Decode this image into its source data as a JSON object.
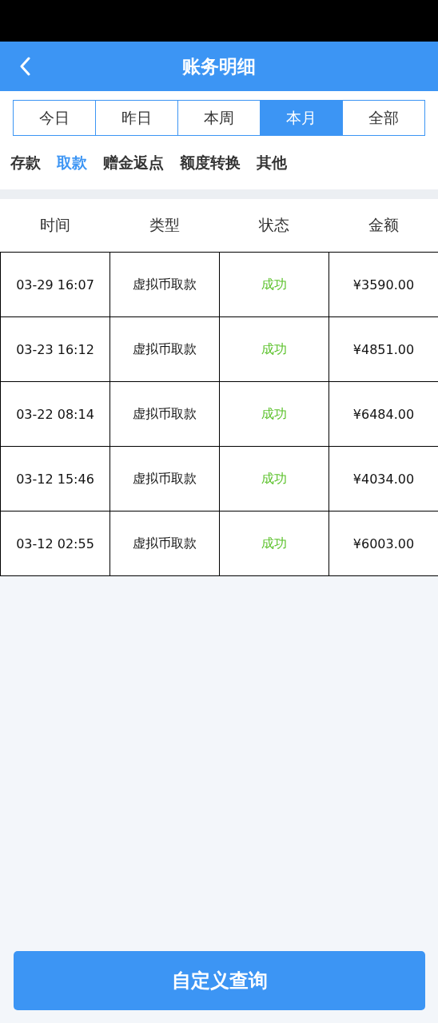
{
  "header": {
    "title": "账务明细"
  },
  "periods": [
    {
      "label": "今日",
      "selected": false
    },
    {
      "label": "昨日",
      "selected": false
    },
    {
      "label": "本周",
      "selected": false
    },
    {
      "label": "本月",
      "selected": true
    },
    {
      "label": "全部",
      "selected": false
    }
  ],
  "categories": [
    {
      "label": "存款",
      "selected": false
    },
    {
      "label": "取款",
      "selected": true
    },
    {
      "label": "赠金返点",
      "selected": false
    },
    {
      "label": "额度转换",
      "selected": false
    },
    {
      "label": "其他",
      "selected": false
    }
  ],
  "table": {
    "columns": [
      "时间",
      "类型",
      "状态",
      "金额"
    ],
    "rows": [
      {
        "time": "03-29 16:07",
        "type": "虚拟币取款",
        "status": "成功",
        "amount": "¥3590.00"
      },
      {
        "time": "03-23 16:12",
        "type": "虚拟币取款",
        "status": "成功",
        "amount": "¥4851.00"
      },
      {
        "time": "03-22 08:14",
        "type": "虚拟币取款",
        "status": "成功",
        "amount": "¥6484.00"
      },
      {
        "time": "03-12 15:46",
        "type": "虚拟币取款",
        "status": "成功",
        "amount": "¥4034.00"
      },
      {
        "time": "03-12 02:55",
        "type": "虚拟币取款",
        "status": "成功",
        "amount": "¥6003.00"
      }
    ]
  },
  "query_button": "自定义查询"
}
